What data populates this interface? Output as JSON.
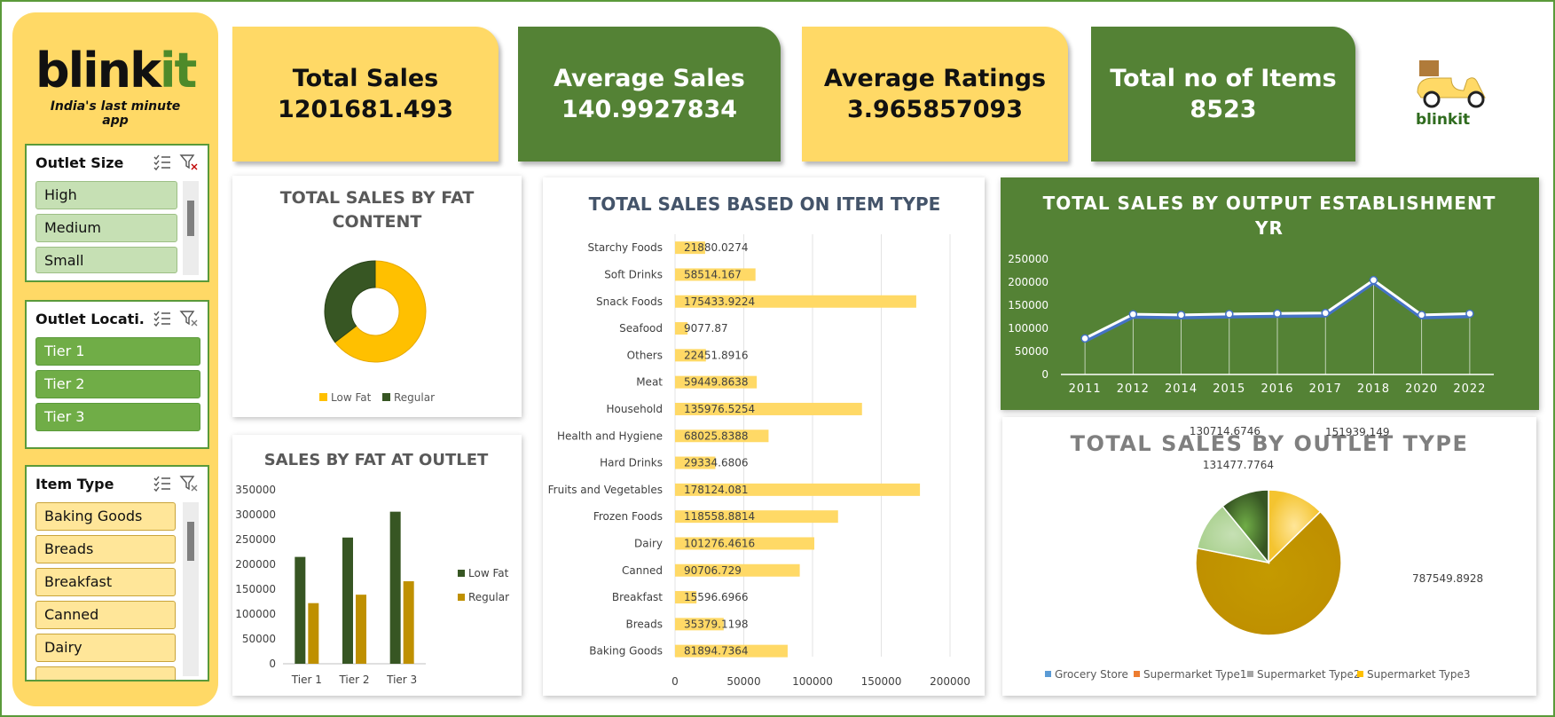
{
  "brand": {
    "name_a": "blink",
    "name_b": "it",
    "tagline": "India's last minute app",
    "small_logo": "blinkit"
  },
  "slicers": {
    "outlet_size": {
      "title": "Outlet Size",
      "items": [
        "High",
        "Medium",
        "Small"
      ]
    },
    "outlet_location": {
      "title": "Outlet Locati...",
      "items": [
        "Tier 1",
        "Tier 2",
        "Tier 3"
      ]
    },
    "item_type": {
      "title": "Item Type",
      "items": [
        "Baking Goods",
        "Breads",
        "Breakfast",
        "Canned",
        "Dairy"
      ]
    }
  },
  "kpis": [
    {
      "label": "Total Sales",
      "value": "1201681.493"
    },
    {
      "label": "Average Sales",
      "value": "140.9927834"
    },
    {
      "label": "Average Ratings",
      "value": "3.965857093"
    },
    {
      "label": "Total no of Items",
      "value": "8523"
    }
  ],
  "icons": {
    "multi_select": "multi-select-icon",
    "clear_filter": "clear-filter-icon",
    "scooter": "delivery-scooter-icon"
  },
  "colors": {
    "yellow": "#ffd966",
    "green": "#548235",
    "dark_green": "#375623",
    "gold": "#bf9000",
    "bright_yellow": "#ffc000"
  },
  "chart_data": [
    {
      "id": "fat_donut",
      "type": "pie",
      "title_line1": "TOTAL SALES BY FAT",
      "title_line2": "CONTENT",
      "labels": [
        "Low Fat",
        "Regular"
      ],
      "values": [
        776319.7,
        425361.8
      ],
      "colors": [
        "#ffc000",
        "#375623"
      ],
      "legend": "bottom"
    },
    {
      "id": "fat_outlet",
      "type": "bar",
      "title": "SALES BY FAT AT OUTLET",
      "categories": [
        "Tier 1",
        "Tier 2",
        "Tier 3"
      ],
      "series": [
        {
          "name": "Low Fat",
          "values": [
            215000,
            254000,
            306000
          ],
          "color": "#375623"
        },
        {
          "name": "Regular",
          "values": [
            122000,
            139000,
            166000
          ],
          "color": "#bf9000"
        }
      ],
      "ylim": [
        0,
        350000
      ],
      "yticks": [
        "0",
        "50000",
        "100000",
        "150000",
        "200000",
        "250000",
        "300000",
        "350000"
      ],
      "legend": "right"
    },
    {
      "id": "item_type",
      "type": "bar",
      "orientation": "horizontal",
      "title": "TOTAL SALES BASED ON ITEM TYPE",
      "categories": [
        "Starchy Foods",
        "Soft Drinks",
        "Snack Foods",
        "Seafood",
        "Others",
        "Meat",
        "Household",
        "Health and Hygiene",
        "Hard Drinks",
        "Fruits and Vegetables",
        "Frozen Foods",
        "Dairy",
        "Canned",
        "Breakfast",
        "Breads",
        "Baking Goods"
      ],
      "values": [
        21880.0274,
        58514.167,
        175433.9224,
        9077.87,
        22451.8916,
        59449.8638,
        135976.5254,
        68025.8388,
        29334.6806,
        178124.081,
        118558.8814,
        101276.4616,
        90706.729,
        15596.6966,
        35379.1198,
        81894.7364
      ],
      "data_labels": [
        "21880.0274",
        "58514.167",
        "175433.9224",
        "9077.87",
        "22451.8916",
        "59449.8638",
        "135976.5254",
        "68025.8388",
        "29334.6806",
        "178124.081",
        "118558.8814",
        "101276.4616",
        "90706.729",
        "15596.6966",
        "35379.1198",
        "81894.7364"
      ],
      "xlim": [
        0,
        200000
      ],
      "xticks": [
        "0",
        "50000",
        "100000",
        "150000",
        "200000"
      ],
      "grid": true,
      "color": "#ffd966"
    },
    {
      "id": "establishment",
      "type": "line",
      "title_line1": "TOTAL SALES BY OUTPUT ESTABLISHMENT",
      "title_line2": "YR",
      "x": [
        "2011",
        "2012",
        "2014",
        "2015",
        "2016",
        "2017",
        "2018",
        "2020",
        "2022"
      ],
      "values": [
        78131.5666,
        130476.8598,
        129103.9604,
        130942.7802,
        132113.3698,
        133103.907,
        204522.257,
        129103.9604,
        131809.0156
      ],
      "ylim": [
        0,
        250000
      ],
      "yticks": [
        "0",
        "50000",
        "100000",
        "150000",
        "200000",
        "250000"
      ],
      "grid": false
    },
    {
      "id": "outlet_type",
      "type": "pie",
      "title": "TOTAL SALES BY OUTLET TYPE",
      "labels": [
        "Grocery Store",
        "Supermarket Type1",
        "Supermarket Type2",
        "Supermarket Type3"
      ],
      "values": [
        151939.149,
        787549.8928,
        131477.7764,
        130714.6746
      ],
      "data_labels": [
        "151939.149",
        "787549.8928",
        "131477.7764",
        "130714.6746"
      ],
      "legend_colors": [
        "#5b9bd5",
        "#ed7d31",
        "#a5a5a5",
        "#ffc000"
      ],
      "legend": "bottom"
    }
  ]
}
